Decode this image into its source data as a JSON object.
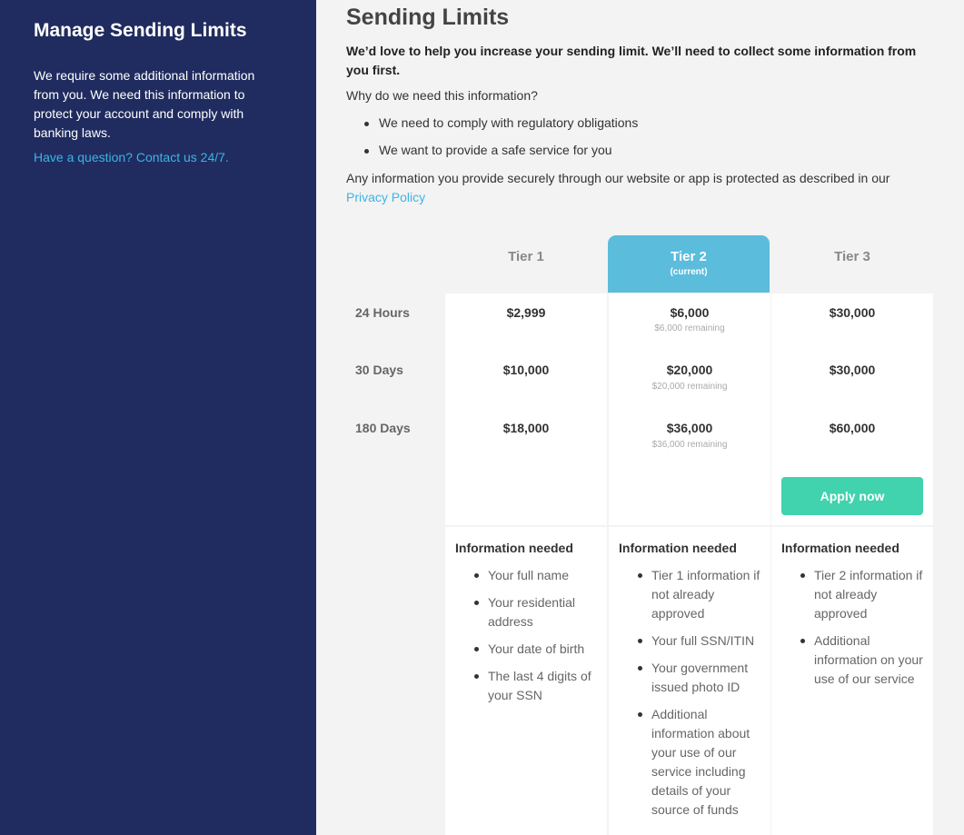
{
  "sidebar": {
    "title": "Manage Sending Limits",
    "body": "We require some additional information from you. We need this information to protect your account and comply with banking laws.",
    "contact_link": "Have a question? Contact us 24/7."
  },
  "main": {
    "title": "Sending Limits",
    "intro": "We’d love to help you increase your sending limit. We’ll need to collect some information from you first.",
    "why": "Why do we need this information?",
    "reasons": [
      "We need to comply with regulatory obligations",
      "We want to provide a safe service for you"
    ],
    "privacy_text": "Any information you provide securely through our website or app is protected as described in our",
    "privacy_link": "Privacy Policy"
  },
  "table": {
    "row_labels": [
      "24 Hours",
      "30 Days",
      "180 Days"
    ],
    "apply_label": "Apply now",
    "info_title": "Information needed",
    "tiers": [
      {
        "name": "Tier 1",
        "amounts": [
          "$2,999",
          "$10,000",
          "$18,000"
        ],
        "info": [
          "Your full name",
          "Your residential address",
          "Your date of birth",
          "The last 4 digits of your SSN"
        ]
      },
      {
        "name": "Tier 2",
        "current_label": "(current)",
        "amounts": [
          "$6,000",
          "$20,000",
          "$36,000"
        ],
        "remaining": [
          "$6,000 remaining",
          "$20,000 remaining",
          "$36,000 remaining"
        ],
        "info": [
          "Tier 1 information if not already approved",
          "Your full SSN/ITIN",
          "Your government issued photo ID",
          "Additional information about your use of our service including details of your source of funds"
        ]
      },
      {
        "name": "Tier 3",
        "amounts": [
          "$30,000",
          "$30,000",
          "$60,000"
        ],
        "info": [
          "Tier 2 information if not already approved",
          "Additional information on your use of our service"
        ]
      }
    ]
  },
  "colors": {
    "sidebar_bg": "#202c5f",
    "link": "#3cb4e6",
    "current_tier": "#5bbcdc",
    "apply_button": "#40d3ad"
  }
}
